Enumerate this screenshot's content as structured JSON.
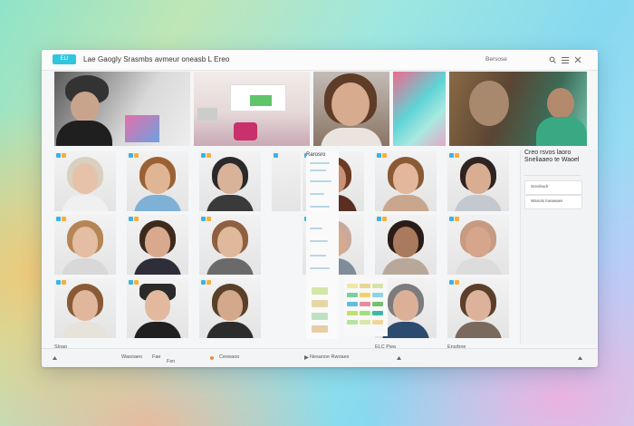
{
  "topbar": {
    "logo_label": "ELI",
    "title": "Lae Gaogly Srasmbs avmeur oneasb L Ereo",
    "right_link": "Bersose",
    "icons": [
      "search-icon",
      "menu-icon",
      "close-icon"
    ]
  },
  "middle_panel": {
    "heading": "Rarosro"
  },
  "right_panel": {
    "title": "Creo rsvos laoro Sneliaaeo te Waoel",
    "card1_label": "Sreolsodr",
    "card2_label": "Wanolo loeawaes"
  },
  "captions": {
    "left": "Sloao",
    "right_1": "ELC Pwa",
    "right_2": "Ensrbne"
  },
  "bottombar": {
    "item1": "Wasoaeo",
    "item2": "Fae",
    "item3": "Fsn",
    "item4": "Ceoeaoo",
    "item5": "Nesanoe Rwoaes"
  },
  "colors": {
    "accent": "#2fc6df",
    "badge_blue": "#3bb3e6",
    "badge_orange": "#f6b03a"
  }
}
